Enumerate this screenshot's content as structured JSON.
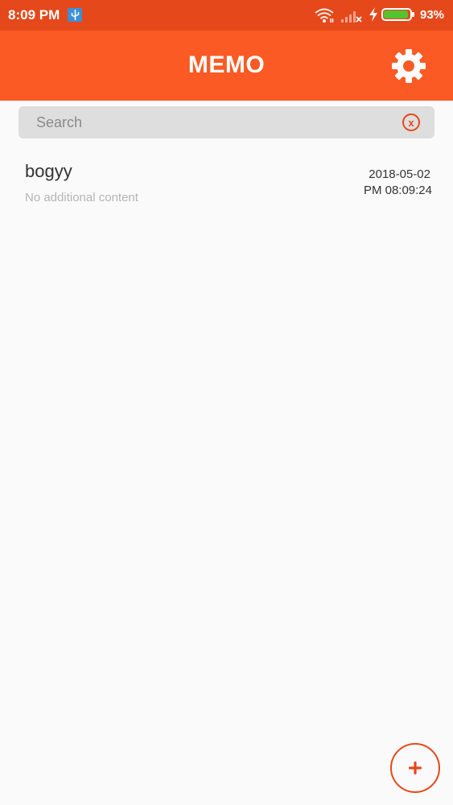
{
  "status_bar": {
    "time": "8:09 PM",
    "battery_percent_label": "93%",
    "battery_level": 0.93,
    "icons": [
      "usb-icon",
      "wifi-icon",
      "signal-icon",
      "charging-icon",
      "battery-icon"
    ]
  },
  "app_bar": {
    "title": "MEMO",
    "settings_icon": "gear-icon"
  },
  "search": {
    "placeholder": "Search",
    "value": "",
    "clear_label": "x"
  },
  "memos": [
    {
      "title": "bogyy",
      "preview": "No additional content",
      "date": "2018-05-02",
      "time": "PM 08:09:24"
    }
  ],
  "fab": {
    "icon": "plus-icon"
  },
  "colors": {
    "status_bar": "#e5481a",
    "app_bar": "#fb5a24",
    "accent": "#e5481a",
    "background": "#fafafa",
    "search_bg": "#dedede",
    "battery": "#57c22f"
  }
}
